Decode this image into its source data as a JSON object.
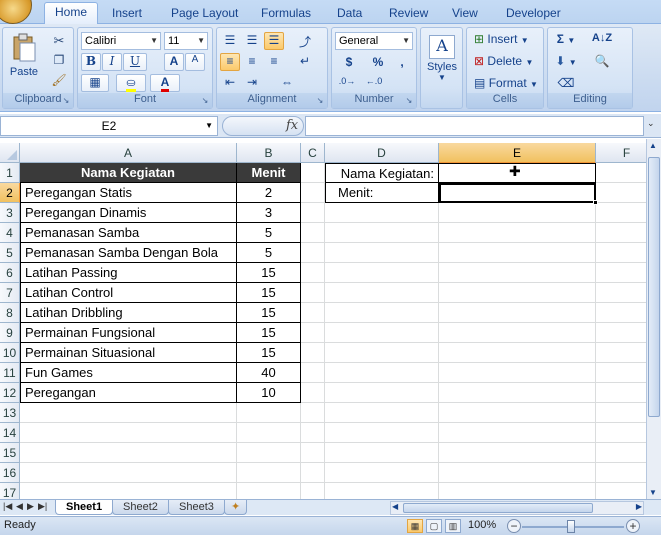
{
  "ribbon": {
    "tabs": [
      {
        "label": "Home",
        "active": true
      },
      {
        "label": "Insert"
      },
      {
        "label": "Page Layout"
      },
      {
        "label": "Formulas"
      },
      {
        "label": "Data"
      },
      {
        "label": "Review"
      },
      {
        "label": "View"
      },
      {
        "label": "Developer"
      }
    ],
    "clipboard": {
      "paste_label": "Paste",
      "group_label": "Clipboard"
    },
    "font": {
      "name": "Calibri",
      "size": "11",
      "bold": "B",
      "italic": "I",
      "underline": "U",
      "grow": "A",
      "shrink": "A",
      "group_label": "Font"
    },
    "alignment": {
      "group_label": "Alignment"
    },
    "number": {
      "format": "General",
      "currency": "$",
      "percent": "%",
      "comma": ",",
      "group_label": "Number"
    },
    "styles": {
      "label": "Styles"
    },
    "cells": {
      "insert": "Insert",
      "delete": "Delete",
      "format": "Format",
      "group_label": "Cells"
    },
    "editing": {
      "sum": "Σ",
      "group_label": "Editing"
    }
  },
  "formula_bar": {
    "name_box": "E2",
    "fx": "fx",
    "content": ""
  },
  "sheet": {
    "columns": [
      "A",
      "B",
      "C",
      "D",
      "E",
      "F"
    ],
    "selected_column": "E",
    "rows": [
      "1",
      "2",
      "3",
      "4",
      "5",
      "6",
      "7",
      "8",
      "9",
      "10",
      "11",
      "12",
      "13",
      "14",
      "15",
      "16",
      "17"
    ],
    "selected_row": "2",
    "table_headers": {
      "name": "Nama Kegiatan",
      "minutes": "Menit"
    },
    "activities": [
      {
        "name": "Peregangan Statis",
        "minutes": "2"
      },
      {
        "name": "Peregangan Dinamis",
        "minutes": "3"
      },
      {
        "name": "Pemanasan Samba",
        "minutes": "5"
      },
      {
        "name": "Pemanasan Samba Dengan Bola",
        "minutes": "5"
      },
      {
        "name": "Latihan Passing",
        "minutes": "15"
      },
      {
        "name": "Latihan Control",
        "minutes": "15"
      },
      {
        "name": "Latihan Dribbling",
        "minutes": "15"
      },
      {
        "name": "Permainan Fungsional",
        "minutes": "15"
      },
      {
        "name": "Permainan Situasional",
        "minutes": "15"
      },
      {
        "name": "Fun Games",
        "minutes": "40"
      },
      {
        "name": "Peregangan",
        "minutes": "10"
      }
    ],
    "lookup": {
      "label_name": "Nama Kegiatan:",
      "label_minutes": "Menit:",
      "value_name": "",
      "value_minutes": ""
    }
  },
  "sheet_tabs": [
    {
      "label": "Sheet1",
      "active": true
    },
    {
      "label": "Sheet2"
    },
    {
      "label": "Sheet3"
    }
  ],
  "status": {
    "text": "Ready",
    "zoom": "100%"
  }
}
